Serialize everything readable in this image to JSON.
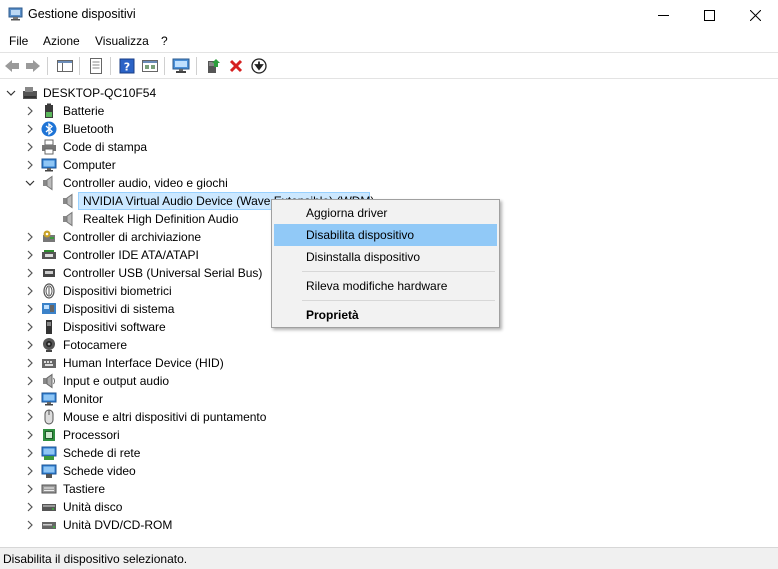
{
  "window": {
    "title": "Gestione dispositivi"
  },
  "menu": {
    "file": "File",
    "azione": "Azione",
    "visualizza": "Visualizza",
    "help": "?"
  },
  "tree": {
    "root": "DESKTOP-QC10F54",
    "categories": [
      "Batterie",
      "Bluetooth",
      "Code di stampa",
      "Computer",
      "Controller audio, video e giochi",
      "NVIDIA Virtual Audio Device (Wave Extensible) (WDM)",
      "Realtek High Definition Audio",
      "Controller di archiviazione",
      "Controller IDE ATA/ATAPI",
      "Controller USB (Universal Serial Bus)",
      "Dispositivi biometrici",
      "Dispositivi di sistema",
      "Dispositivi software",
      "Fotocamere",
      "Human Interface Device (HID)",
      "Input e output audio",
      "Monitor",
      "Mouse e altri dispositivi di puntamento",
      "Processori",
      "Schede di rete",
      "Schede video",
      "Tastiere",
      "Unità disco",
      "Unità DVD/CD-ROM"
    ]
  },
  "context_menu": {
    "update_driver": "Aggiorna driver",
    "disable_device": "Disabilita dispositivo",
    "uninstall_device": "Disinstalla dispositivo",
    "scan_hardware": "Rileva modifiche hardware",
    "properties": "Proprietà"
  },
  "status": {
    "text": "Disabilita il dispositivo selezionato."
  }
}
